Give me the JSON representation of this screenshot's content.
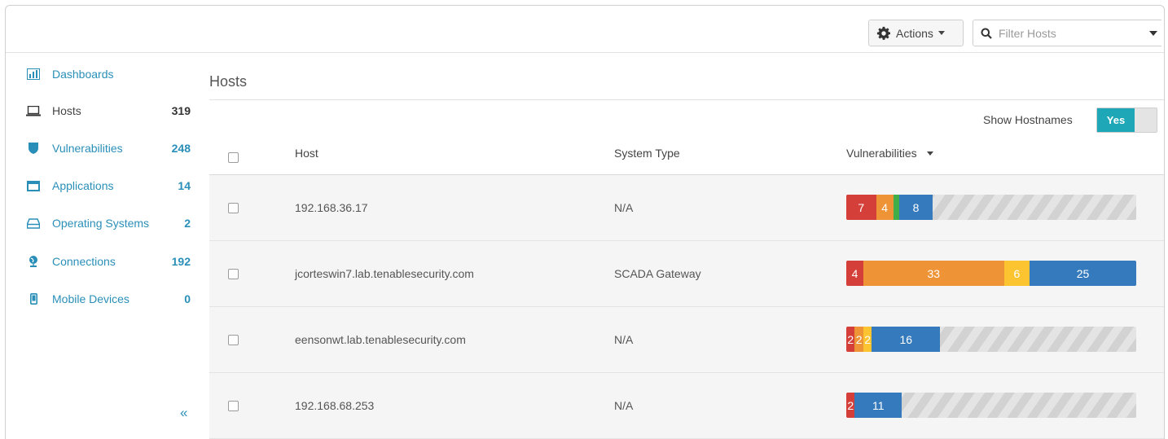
{
  "toolbar": {
    "actions_label": "Actions",
    "filter_placeholder": "Filter Hosts"
  },
  "sidebar": {
    "items": [
      {
        "label": "Dashboards",
        "count": "",
        "icon": "bar-chart-icon"
      },
      {
        "label": "Hosts",
        "count": "319",
        "icon": "laptop-icon"
      },
      {
        "label": "Vulnerabilities",
        "count": "248",
        "icon": "shield-icon"
      },
      {
        "label": "Applications",
        "count": "14",
        "icon": "window-icon"
      },
      {
        "label": "Operating Systems",
        "count": "2",
        "icon": "hard-drive-icon"
      },
      {
        "label": "Connections",
        "count": "192",
        "icon": "globe-icon"
      },
      {
        "label": "Mobile Devices",
        "count": "0",
        "icon": "mobile-icon"
      }
    ],
    "collapse_label": "«"
  },
  "main": {
    "title": "Hosts",
    "show_hostnames_label": "Show Hostnames",
    "toggle_on_label": "Yes",
    "columns": {
      "host": "Host",
      "system_type": "System Type",
      "vulnerabilities": "Vulnerabilities"
    },
    "rows": [
      {
        "host": "192.168.36.17",
        "system_type": "N/A",
        "vulns": [
          {
            "label": "7",
            "value": 7,
            "color": "#d43f3a"
          },
          {
            "label": "4",
            "value": 4,
            "color": "#ee9336"
          },
          {
            "label": "",
            "value": 1,
            "color": "#3fae49"
          },
          {
            "label": "8",
            "value": 8,
            "color": "#357abd"
          }
        ]
      },
      {
        "host": "jcorteswin7.lab.tenablesecurity.com",
        "system_type": "SCADA Gateway",
        "vulns": [
          {
            "label": "4",
            "value": 4,
            "color": "#d43f3a"
          },
          {
            "label": "33",
            "value": 33,
            "color": "#ee9336"
          },
          {
            "label": "6",
            "value": 6,
            "color": "#fdc431"
          },
          {
            "label": "25",
            "value": 25,
            "color": "#357abd"
          }
        ]
      },
      {
        "host": "eensonwt.lab.tenablesecurity.com",
        "system_type": "N/A",
        "vulns": [
          {
            "label": "2",
            "value": 2,
            "color": "#d43f3a"
          },
          {
            "label": "2",
            "value": 2,
            "color": "#ee9336"
          },
          {
            "label": "2",
            "value": 2,
            "color": "#fdc431"
          },
          {
            "label": "16",
            "value": 16,
            "color": "#357abd"
          }
        ]
      },
      {
        "host": "192.168.68.253",
        "system_type": "N/A",
        "vulns": [
          {
            "label": "2",
            "value": 2,
            "color": "#d43f3a"
          },
          {
            "label": "11",
            "value": 11,
            "color": "#357abd"
          }
        ]
      }
    ]
  }
}
